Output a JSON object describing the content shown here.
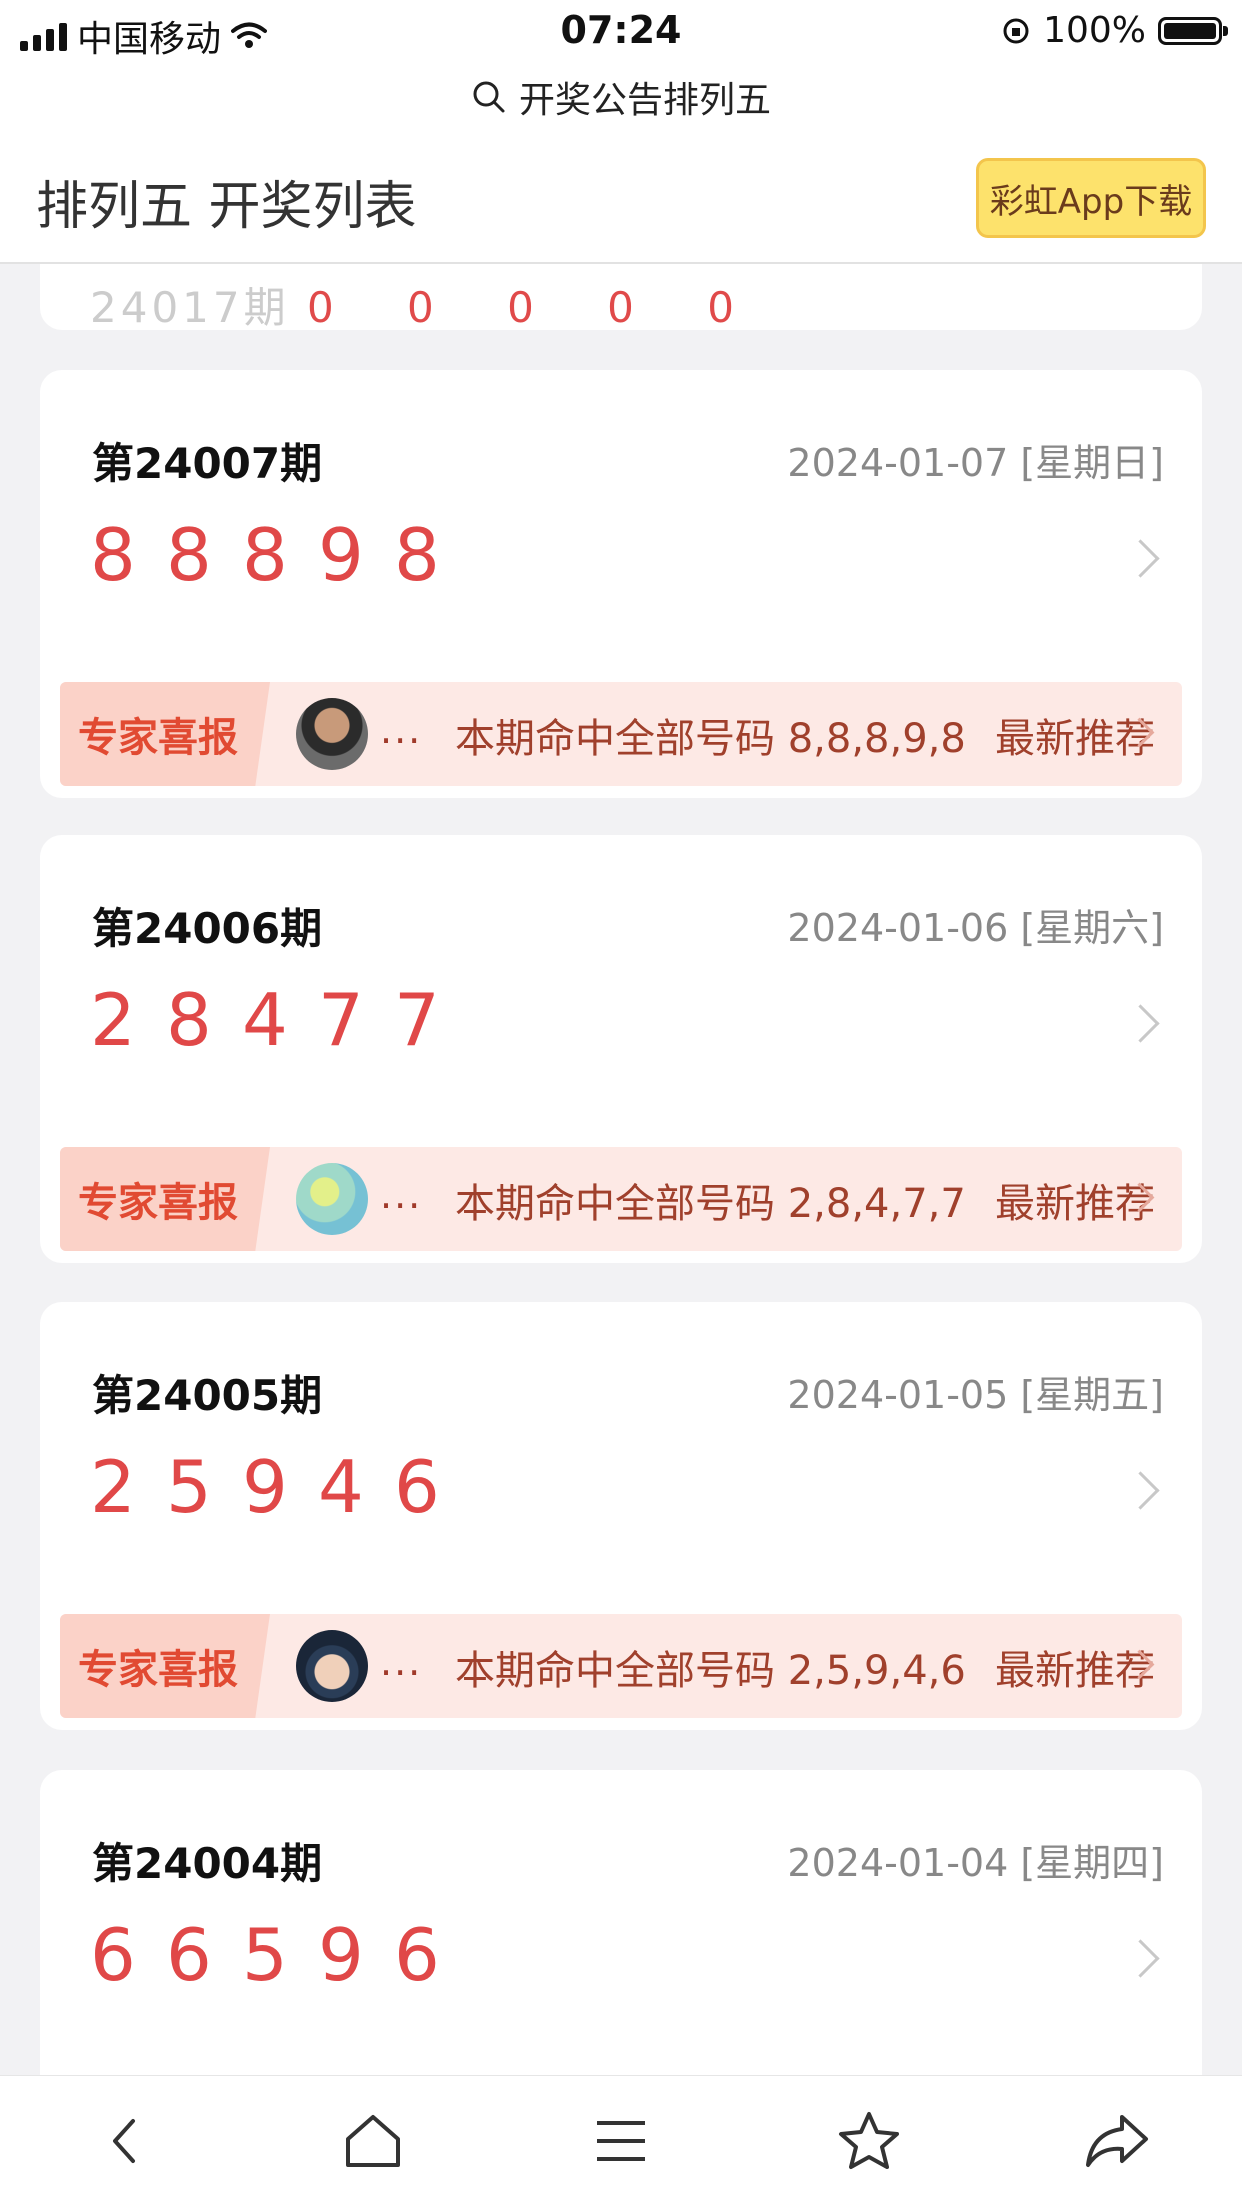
{
  "status_bar": {
    "carrier": "中国移动",
    "time": "07:24",
    "battery": "100%"
  },
  "address_bar": {
    "text": "开奖公告排列五"
  },
  "header": {
    "title": "排列五 开奖列表",
    "download_button": "彩虹App下载"
  },
  "partial_card": {
    "issue": "24017期",
    "numbers": "0 0 0 0 0"
  },
  "draws": [
    {
      "issue": "第24007期",
      "date": "2024-01-07 [星期日]",
      "numbers": [
        "8",
        "8",
        "8",
        "9",
        "8"
      ],
      "expert_tag": "专家喜报",
      "ellipsis": "...",
      "hit_text": "本期命中全部号码 8,8,8,9,8",
      "recommend": "最新推荐",
      "avatar": "person-photo"
    },
    {
      "issue": "第24006期",
      "date": "2024-01-06 [星期六]",
      "numbers": [
        "2",
        "8",
        "4",
        "7",
        "7"
      ],
      "expert_tag": "专家喜报",
      "ellipsis": "...",
      "hit_text": "本期命中全部号码 2,8,4,7,7",
      "recommend": "最新推荐",
      "avatar": "text-image"
    },
    {
      "issue": "第24005期",
      "date": "2024-01-05 [星期五]",
      "numbers": [
        "2",
        "5",
        "9",
        "4",
        "6"
      ],
      "expert_tag": "专家喜报",
      "ellipsis": "...",
      "hit_text": "本期命中全部号码 2,5,9,4,6",
      "recommend": "最新推荐",
      "avatar": "baby-photo"
    },
    {
      "issue": "第24004期",
      "date": "2024-01-04 [星期四]",
      "numbers": [
        "6",
        "6",
        "5",
        "9",
        "6"
      ]
    }
  ],
  "tab_bar": {
    "icons": [
      "back-icon",
      "home-icon",
      "menu-icon",
      "star-icon",
      "share-icon"
    ]
  },
  "colors": {
    "number_red": "#e04848",
    "download_yellow": "#fde26c",
    "expert_bg": "#fde9e5",
    "expert_tag": "#e14a32"
  }
}
